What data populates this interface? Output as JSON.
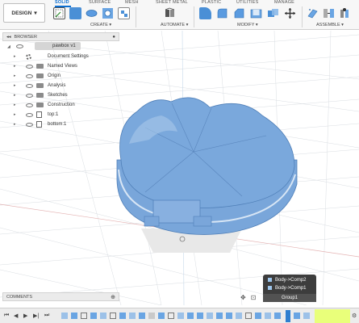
{
  "toolbar": {
    "workspace_label": "DESIGN",
    "tabs": [
      {
        "label": "SOLID",
        "active": true
      },
      {
        "label": "SURFACE",
        "active": false
      },
      {
        "label": "MESH",
        "active": false
      },
      {
        "label": "SHEET METAL",
        "active": false
      },
      {
        "label": "PLASTIC",
        "active": false
      },
      {
        "label": "UTILITIES",
        "active": false
      },
      {
        "label": "MANAGE",
        "active": false
      }
    ],
    "groups": [
      {
        "label": "CREATE ▾"
      },
      {
        "label": "AUTOMATE ▾"
      },
      {
        "label": "MODIFY ▾"
      },
      {
        "label": "ASSEMBLE ▾"
      }
    ],
    "accent_color": "#0a6ed1"
  },
  "browser": {
    "title": "BROWSER",
    "root": "pawbox v1",
    "items": [
      {
        "label": "Document Settings",
        "icon": "gear-icon"
      },
      {
        "label": "Named Views",
        "icon": "folder-icon"
      },
      {
        "label": "Origin",
        "icon": "folder-icon"
      },
      {
        "label": "Analysis",
        "icon": "folder-icon"
      },
      {
        "label": "Sketches",
        "icon": "folder-icon"
      },
      {
        "label": "Construction",
        "icon": "folder-icon"
      },
      {
        "label": "top:1",
        "icon": "component-icon"
      },
      {
        "label": "bottom:1",
        "icon": "component-icon"
      }
    ]
  },
  "comments": {
    "title": "COMMENTS"
  },
  "popup": {
    "items": [
      "Body->Comp2",
      "Body->Comp1"
    ],
    "group_label": "Group1"
  },
  "model": {
    "body_color": "#7aa6d9",
    "highlight_color": "#a9c8ea"
  }
}
